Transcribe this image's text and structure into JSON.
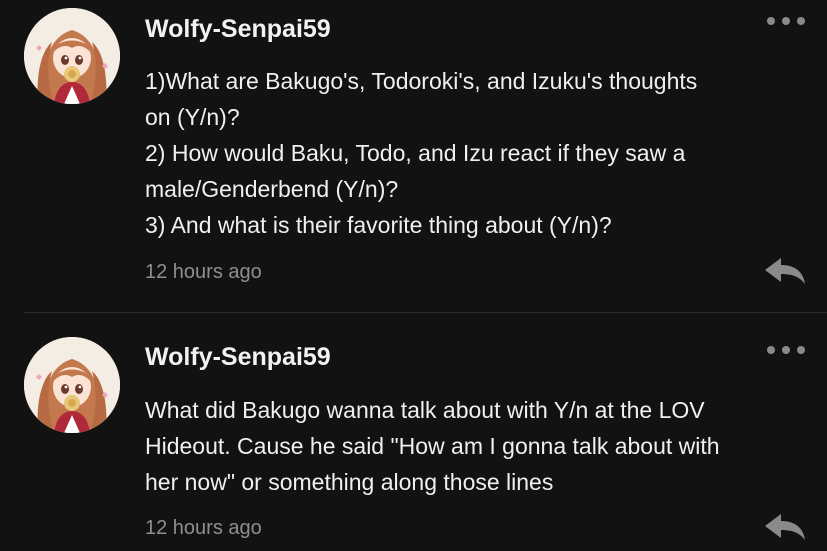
{
  "comments": [
    {
      "username": "Wolfy-Senpai59",
      "lines": [
        "1)What are Bakugo's, Todoroki's, and Izuku's thoughts",
        "on (Y/n)?",
        "2) How would Baku, Todo, and Izu react if they saw a",
        "male/Genderbend (Y/n)?",
        "3) And what is their favorite thing about (Y/n)?"
      ],
      "timestamp": "12 hours ago"
    },
    {
      "username": "Wolfy-Senpai59",
      "lines": [
        "What did Bakugo wanna talk about with Y/n at the LOV",
        "Hideout. Cause he said \"How am I gonna talk about with",
        "her now\" or something along those lines"
      ],
      "timestamp": "12 hours ago"
    }
  ],
  "icons": {
    "avatar": "anime-girl-avatar",
    "more": "more-options-icon",
    "reply": "reply-arrow-icon"
  },
  "colors": {
    "background": "#121212",
    "text": "#f0f0f0",
    "muted": "#8e8e8e"
  }
}
